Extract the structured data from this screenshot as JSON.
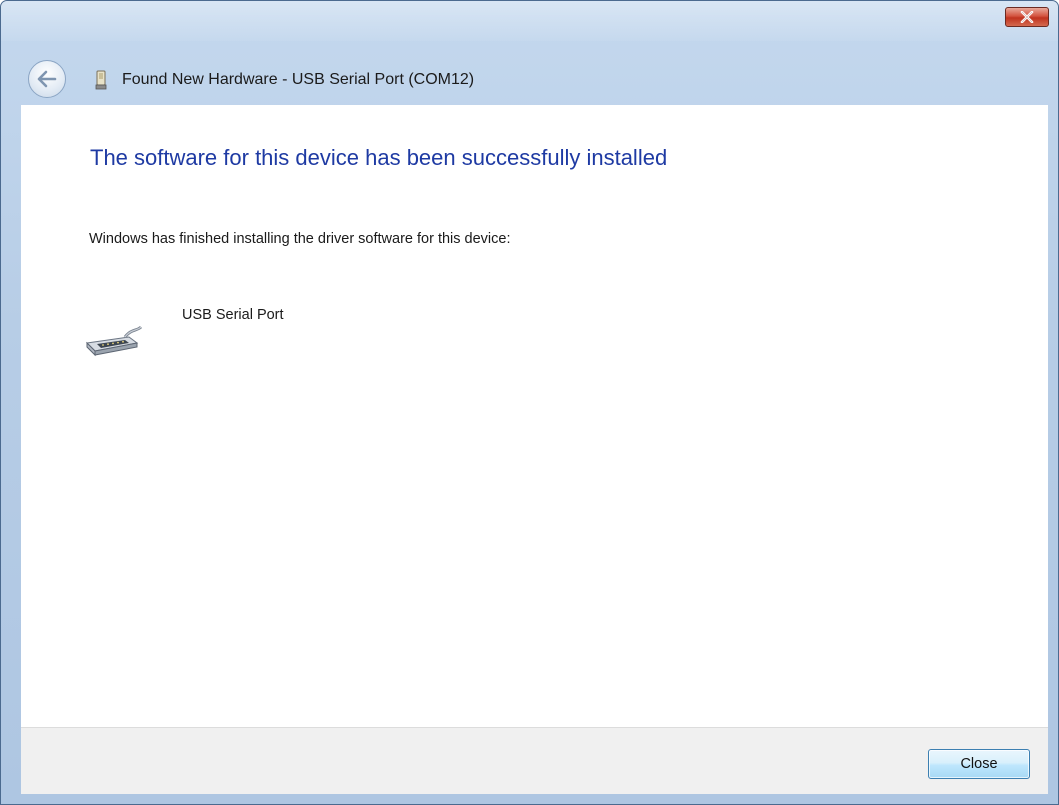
{
  "window": {
    "title": "Found New Hardware - USB Serial Port (COM12)",
    "close_icon": "close-icon",
    "back_icon": "back-arrow-icon",
    "title_icon": "usb-device-icon"
  },
  "content": {
    "heading": "The software for this device has been successfully installed",
    "description": "Windows has finished installing the driver software for this device:",
    "device": {
      "name": "USB Serial Port",
      "icon": "serial-port-icon"
    }
  },
  "footer": {
    "close_label": "Close"
  },
  "colors": {
    "heading": "#1e3aa3",
    "frame": "#b7cde6",
    "close_x": "#c0331f"
  }
}
